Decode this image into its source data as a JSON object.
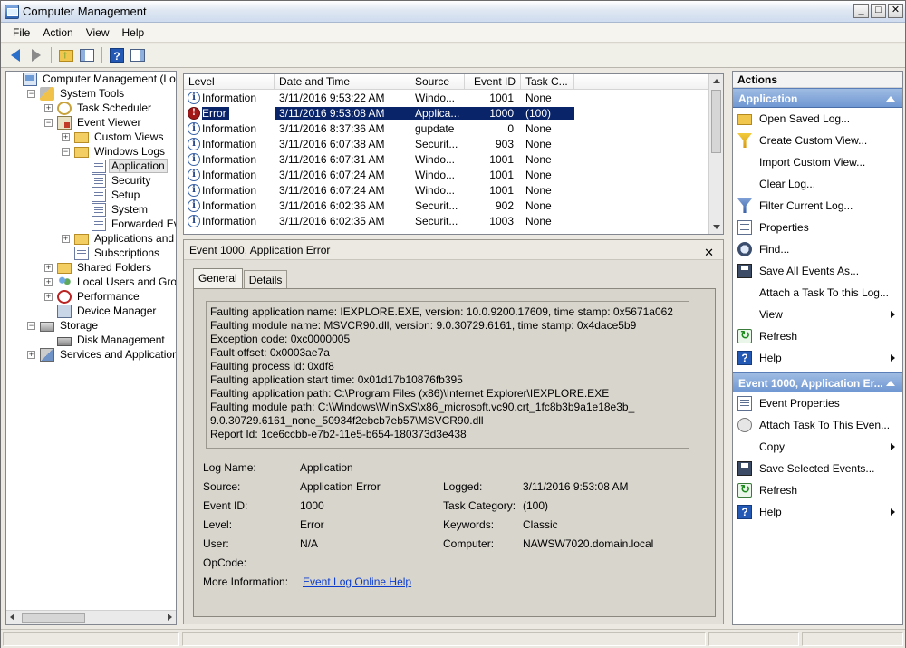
{
  "window": {
    "title": "Computer Management"
  },
  "menu": [
    "File",
    "Action",
    "View",
    "Help"
  ],
  "toolbar": {
    "icons": [
      "back-icon",
      "forward-icon",
      "up-folder-icon",
      "show-hide-tree-icon",
      "help-icon",
      "show-hide-action-pane-icon"
    ]
  },
  "tree": [
    {
      "label": "Computer Management (Local)",
      "icon": "computer",
      "depth": 0,
      "exp": "none"
    },
    {
      "label": "System Tools",
      "icon": "tools",
      "depth": 1,
      "exp": "-"
    },
    {
      "label": "Task Scheduler",
      "icon": "clock",
      "depth": 2,
      "exp": "+"
    },
    {
      "label": "Event Viewer",
      "icon": "viewer",
      "depth": 2,
      "exp": "-"
    },
    {
      "label": "Custom Views",
      "icon": "folder",
      "depth": 3,
      "exp": "+"
    },
    {
      "label": "Windows Logs",
      "icon": "folder",
      "depth": 3,
      "exp": "-"
    },
    {
      "label": "Application",
      "icon": "log",
      "depth": 4,
      "exp": "none",
      "selected": true
    },
    {
      "label": "Security",
      "icon": "log",
      "depth": 4,
      "exp": "none"
    },
    {
      "label": "Setup",
      "icon": "log",
      "depth": 4,
      "exp": "none"
    },
    {
      "label": "System",
      "icon": "log",
      "depth": 4,
      "exp": "none"
    },
    {
      "label": "Forwarded Events",
      "icon": "log",
      "depth": 4,
      "exp": "none"
    },
    {
      "label": "Applications and Servi",
      "icon": "folder",
      "depth": 3,
      "exp": "+"
    },
    {
      "label": "Subscriptions",
      "icon": "log",
      "depth": 3,
      "exp": "none"
    },
    {
      "label": "Shared Folders",
      "icon": "folder",
      "depth": 2,
      "exp": "+"
    },
    {
      "label": "Local Users and Groups",
      "icon": "users",
      "depth": 2,
      "exp": "+"
    },
    {
      "label": "Performance",
      "icon": "perf",
      "depth": 2,
      "exp": "+"
    },
    {
      "label": "Device Manager",
      "icon": "device",
      "depth": 2,
      "exp": "none"
    },
    {
      "label": "Storage",
      "icon": "storage",
      "depth": 1,
      "exp": "-"
    },
    {
      "label": "Disk Management",
      "icon": "disk",
      "depth": 2,
      "exp": "none"
    },
    {
      "label": "Services and Applications",
      "icon": "services",
      "depth": 1,
      "exp": "+"
    }
  ],
  "events": {
    "columns": [
      "Level",
      "Date and Time",
      "Source",
      "Event ID",
      "Task C..."
    ],
    "rows": [
      {
        "level": "Information",
        "datetime": "3/11/2016 9:53:22 AM",
        "source": "Windo...",
        "event_id": "1001",
        "task": "None"
      },
      {
        "level": "Error",
        "datetime": "3/11/2016 9:53:08 AM",
        "source": "Applica...",
        "event_id": "1000",
        "task": "(100)",
        "selected": true
      },
      {
        "level": "Information",
        "datetime": "3/11/2016 8:37:36 AM",
        "source": "gupdate",
        "event_id": "0",
        "task": "None"
      },
      {
        "level": "Information",
        "datetime": "3/11/2016 6:07:38 AM",
        "source": "Securit...",
        "event_id": "903",
        "task": "None"
      },
      {
        "level": "Information",
        "datetime": "3/11/2016 6:07:31 AM",
        "source": "Windo...",
        "event_id": "1001",
        "task": "None"
      },
      {
        "level": "Information",
        "datetime": "3/11/2016 6:07:24 AM",
        "source": "Windo...",
        "event_id": "1001",
        "task": "None"
      },
      {
        "level": "Information",
        "datetime": "3/11/2016 6:07:24 AM",
        "source": "Windo...",
        "event_id": "1001",
        "task": "None"
      },
      {
        "level": "Information",
        "datetime": "3/11/2016 6:02:36 AM",
        "source": "Securit...",
        "event_id": "902",
        "task": "None"
      },
      {
        "level": "Information",
        "datetime": "3/11/2016 6:02:35 AM",
        "source": "Securit...",
        "event_id": "1003",
        "task": "None"
      }
    ]
  },
  "detail": {
    "title": "Event 1000, Application Error",
    "close": "✕",
    "tabs": [
      "General",
      "Details"
    ],
    "description": [
      "Faulting application name: IEXPLORE.EXE, version: 10.0.9200.17609, time stamp: 0x5671a062",
      "Faulting module name: MSVCR90.dll, version: 9.0.30729.6161, time stamp: 0x4dace5b9",
      "Exception code: 0xc0000005",
      "Fault offset: 0x0003ae7a",
      "Faulting process id: 0xdf8",
      "Faulting application start time: 0x01d17b10876fb395",
      "Faulting application path: C:\\Program Files (x86)\\Internet Explorer\\IEXPLORE.EXE",
      "Faulting module path: C:\\Windows\\WinSxS\\x86_microsoft.vc90.crt_1fc8b3b9a1e18e3b_",
      "9.0.30729.6161_none_50934f2ebcb7eb57\\MSVCR90.dll",
      "Report Id: 1ce6ccbb-e7b2-11e5-b654-180373d3e438"
    ],
    "labels": {
      "log_name": "Log Name:",
      "source": "Source:",
      "event_id": "Event ID:",
      "level": "Level:",
      "user": "User:",
      "opcode": "OpCode:",
      "more_info": "More Information:",
      "logged": "Logged:",
      "task_category": "Task Category:",
      "keywords": "Keywords:",
      "computer": "Computer:"
    },
    "values": {
      "log_name": "Application",
      "source": "Application Error",
      "event_id": "1000",
      "level": "Error",
      "user": "N/A",
      "opcode": "",
      "more_info_link": "Event Log Online Help",
      "logged": "3/11/2016 9:53:08 AM",
      "task_category": "(100)",
      "keywords": "Classic",
      "computer": "NAWSW7020.domain.local"
    }
  },
  "actions": {
    "header": "Actions",
    "sections": [
      {
        "title": "Application",
        "items": [
          {
            "label": "Open Saved Log...",
            "icon": "open"
          },
          {
            "label": "Create Custom View...",
            "icon": "filter"
          },
          {
            "label": "Import Custom View...",
            "icon": "none"
          },
          {
            "label": "Clear Log...",
            "icon": "none"
          },
          {
            "label": "Filter Current Log...",
            "icon": "filter2"
          },
          {
            "label": "Properties",
            "icon": "props"
          },
          {
            "label": "Find...",
            "icon": "find"
          },
          {
            "label": "Save All Events As...",
            "icon": "save"
          },
          {
            "label": "Attach a Task To this Log...",
            "icon": "none"
          },
          {
            "label": "View",
            "icon": "none",
            "submenu": true
          },
          {
            "label": "Refresh",
            "icon": "refresh"
          },
          {
            "label": "Help",
            "icon": "help",
            "submenu": true
          }
        ]
      },
      {
        "title": "Event 1000, Application Er...",
        "items": [
          {
            "label": "Event Properties",
            "icon": "props"
          },
          {
            "label": "Attach Task To This Even...",
            "icon": "task"
          },
          {
            "label": "Copy",
            "icon": "none",
            "submenu": true
          },
          {
            "label": "Save Selected Events...",
            "icon": "save"
          },
          {
            "label": "Refresh",
            "icon": "refresh"
          },
          {
            "label": "Help",
            "icon": "help",
            "submenu": true
          }
        ]
      }
    ]
  }
}
